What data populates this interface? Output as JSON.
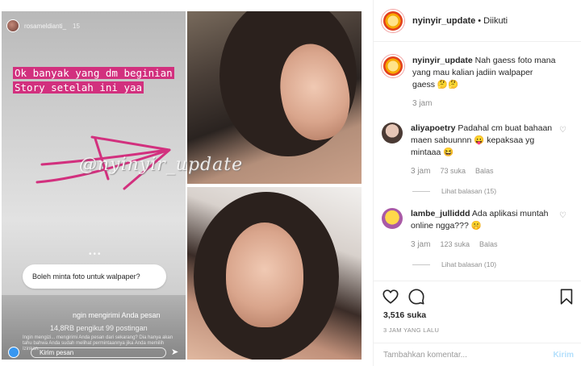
{
  "story": {
    "username": "rosameldianti_",
    "time": "15",
    "caption": "Ok banyak yang dm beginian Story setelah ini yaa",
    "watermark": "@nyinyir_update",
    "question": "Boleh minta foto untuk walpaper?",
    "dm_title": "ngin mengirimi Anda pesan",
    "dm_stats": "14,8RB pengikut 99 postingan",
    "dm_note": "Ingin mengizi... mengirimi Anda pesan dari sekarang? Dia hanya akan tahu bahwa Anda sudah melihat permintaannya jika Anda memilih Izinkan.",
    "reply_placeholder": "Kirim pesan"
  },
  "post": {
    "username": "nyinyir_update",
    "separator": "•",
    "follow_status": "Diikuti",
    "caption_user": "nyinyir_update",
    "caption_text": "Nah gaess foto mana yang mau kalian jadiin walpaper gaess 🤔🤔",
    "caption_time": "3 jam"
  },
  "comments": [
    {
      "username": "aliyapoetry",
      "text": "Padahal cm buat bahaan maen sabuunnn 😛 kepaksaa yg mintaaa 😆",
      "time": "3 jam",
      "likes": "73 suka",
      "reply_label": "Balas",
      "view_replies": "Lihat balasan (15)"
    },
    {
      "username": "lambe_julliddd",
      "text": "Ada aplikasi muntah online ngga??? 🤫",
      "time": "3 jam",
      "likes": "123 suka",
      "reply_label": "Balas",
      "view_replies": "Lihat balasan (10)"
    }
  ],
  "actions": {
    "like_count": "3,516 suka",
    "timestamp": "3 JAM YANG LALU",
    "comment_placeholder": "Tambahkan komentar...",
    "post_label": "Kirim"
  },
  "icons": {
    "like": "heart-icon",
    "comment": "comment-icon",
    "save": "bookmark-icon"
  },
  "colors": {
    "story_highlight": "#d2307e",
    "arrow": "#d2307e",
    "link_blue": "#b2dffc",
    "muted": "#8e8e8e"
  }
}
